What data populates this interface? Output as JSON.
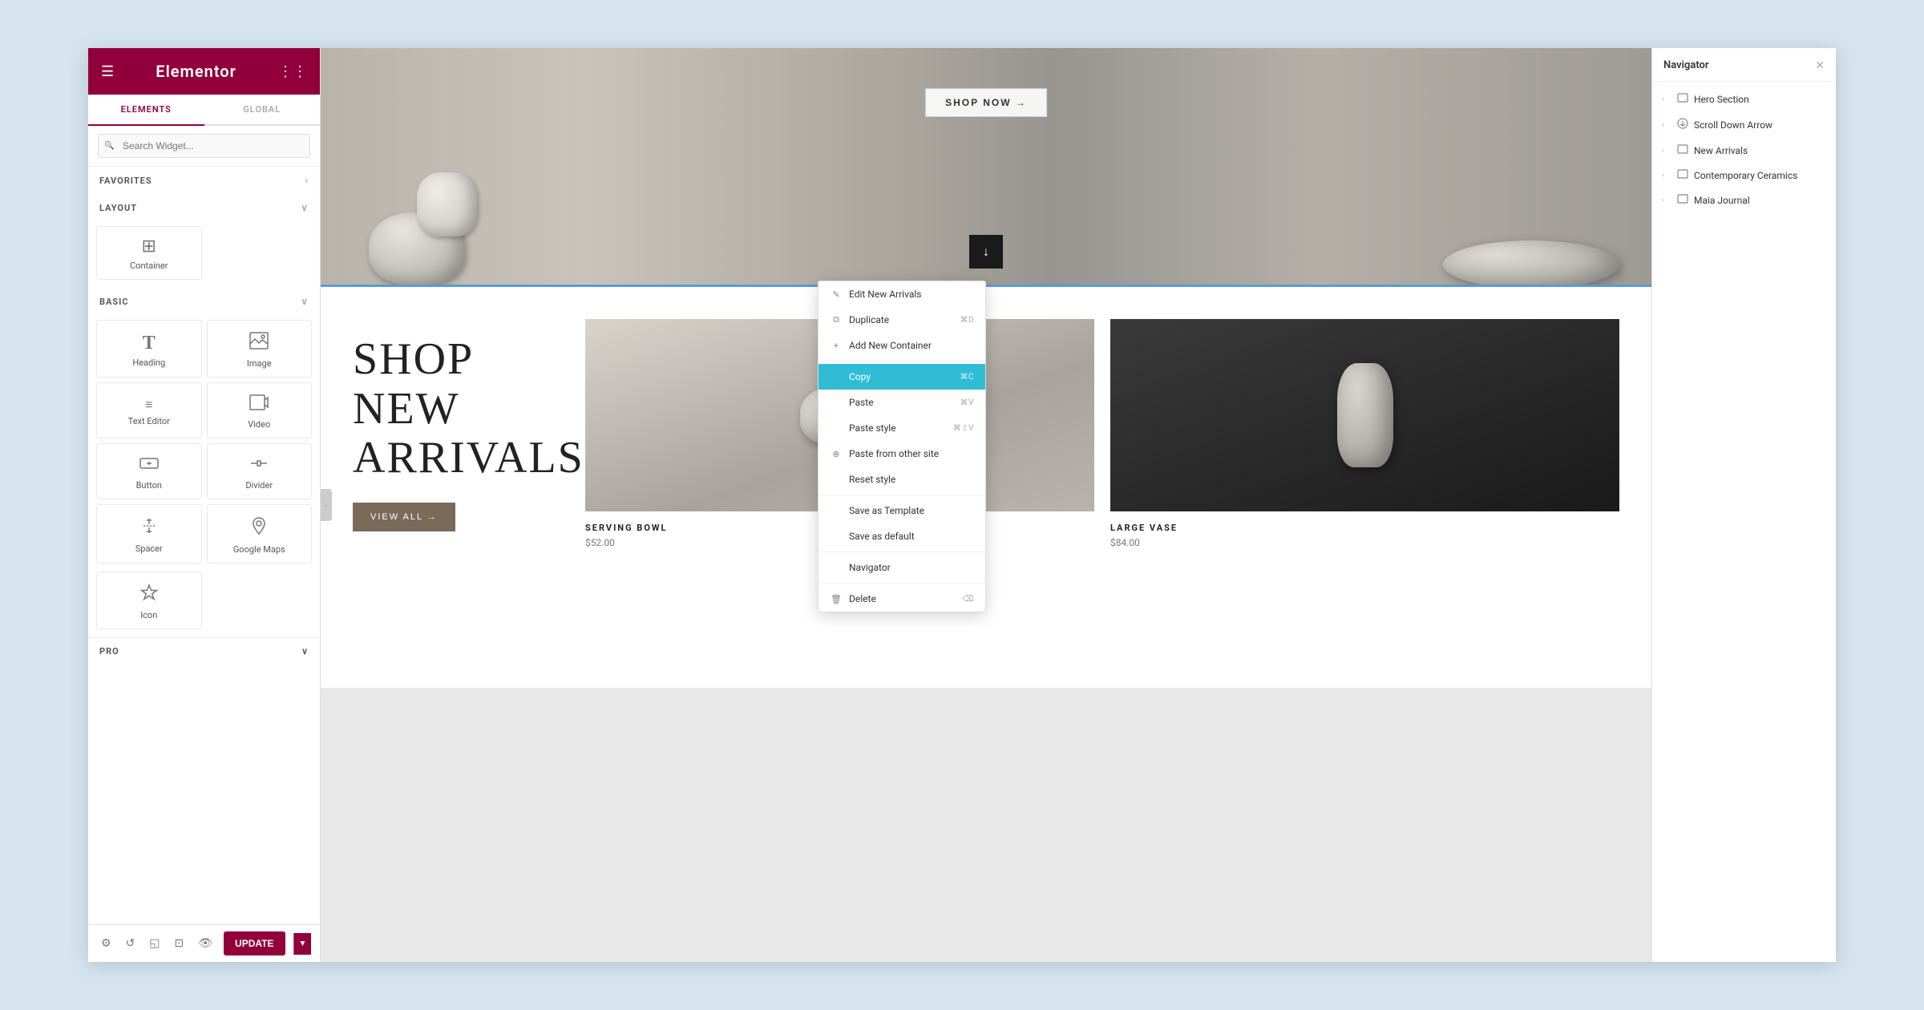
{
  "app": {
    "title": "Elementor"
  },
  "left_panel": {
    "logo": "elementor",
    "tab_elements": "ELEMENTS",
    "tab_global": "GLOBAL",
    "search_placeholder": "Search Widget...",
    "favorites_label": "FAVORITES",
    "layout_label": "LAYOUT",
    "basic_label": "BASIC",
    "pro_label": "PRO",
    "widgets": [
      {
        "id": "container",
        "label": "Container",
        "icon": "⊞"
      },
      {
        "id": "heading",
        "label": "Heading",
        "icon": "T"
      },
      {
        "id": "image",
        "label": "Image",
        "icon": "🖼"
      },
      {
        "id": "text-editor",
        "label": "Text Editor",
        "icon": "≡"
      },
      {
        "id": "video",
        "label": "Video",
        "icon": "▶"
      },
      {
        "id": "button",
        "label": "Button",
        "icon": "⬡"
      },
      {
        "id": "divider",
        "label": "Divider",
        "icon": "÷"
      },
      {
        "id": "spacer",
        "label": "Spacer",
        "icon": "⇕"
      },
      {
        "id": "google-maps",
        "label": "Google Maps",
        "icon": "📍"
      },
      {
        "id": "icon",
        "label": "Icon",
        "icon": "★"
      }
    ],
    "toolbar": {
      "settings_icon": "⚙",
      "history_icon": "↺",
      "responsive_icon": "◱",
      "navigator_icon": "⊡",
      "preview_icon": "👁",
      "update_label": "UPDATE"
    }
  },
  "canvas": {
    "hero": {
      "shop_now_label": "SHOP NOW →"
    },
    "scroll_arrow": "↓",
    "new_arrivals": {
      "heading_line1": "SHOP",
      "heading_line2": "NEW",
      "heading_line3": "ARRIVALS",
      "view_all_label": "VIEW ALL →"
    },
    "products": [
      {
        "id": "serving-bowl",
        "name": "SERVING BOWL",
        "price": "$52.00"
      },
      {
        "id": "large-vase",
        "name": "LARGE VASE",
        "price": "$84.00"
      }
    ]
  },
  "context_menu": {
    "items": [
      {
        "id": "edit-new-arrivals",
        "label": "Edit New Arrivals",
        "icon": "✎",
        "shortcut": ""
      },
      {
        "id": "duplicate",
        "label": "Duplicate",
        "icon": "⧉",
        "shortcut": "⌘D"
      },
      {
        "id": "add-new-container",
        "label": "Add New Container",
        "icon": "+",
        "shortcut": ""
      },
      {
        "id": "copy",
        "label": "Copy",
        "icon": "",
        "shortcut": "⌘C",
        "highlighted": true
      },
      {
        "id": "paste",
        "label": "Paste",
        "icon": "",
        "shortcut": "⌘V"
      },
      {
        "id": "paste-style",
        "label": "Paste style",
        "icon": "",
        "shortcut": "⌘⇧V"
      },
      {
        "id": "paste-from-other-site",
        "label": "Paste from other site",
        "icon": "⊕",
        "shortcut": ""
      },
      {
        "id": "reset-style",
        "label": "Reset style",
        "icon": "",
        "shortcut": ""
      },
      {
        "id": "save-as-template",
        "label": "Save as Template",
        "icon": "",
        "shortcut": ""
      },
      {
        "id": "save-as-default",
        "label": "Save as default",
        "icon": "",
        "shortcut": ""
      },
      {
        "id": "navigator",
        "label": "Navigator",
        "icon": "",
        "shortcut": ""
      },
      {
        "id": "delete",
        "label": "Delete",
        "icon": "🗑",
        "shortcut": "⌫"
      }
    ]
  },
  "navigator": {
    "title": "Navigator",
    "items": [
      {
        "id": "hero-section",
        "label": "Hero Section",
        "has_children": true
      },
      {
        "id": "scroll-down-arrow",
        "label": "Scroll Down Arrow",
        "has_children": true
      },
      {
        "id": "new-arrivals",
        "label": "New Arrivals",
        "has_children": true
      },
      {
        "id": "contemporary-ceramics",
        "label": "Contemporary Ceramics",
        "has_children": true
      },
      {
        "id": "maia-journal",
        "label": "Maia Journal",
        "has_children": true
      }
    ]
  }
}
